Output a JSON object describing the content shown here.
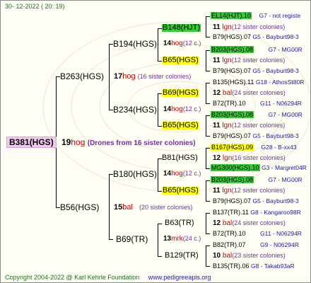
{
  "header": {
    "date": "30-  12-2022  ( 20: 19)"
  },
  "root": {
    "label": "B381(HGS)",
    "num": "19",
    "breeder": "hog",
    "note": "(Drones from 16 sister colonies)"
  },
  "gen1": [
    {
      "label": "B263(HGS)",
      "num": "17",
      "breeder": "hog",
      "note": "(16 sister colonies)"
    },
    {
      "label": "B56(HGS)",
      "num": "15",
      "breeder": "bal",
      "note": "(20 sister colonies)"
    }
  ],
  "gen2": [
    {
      "label": "B194(HGS)",
      "num": "14",
      "breeder": "hog",
      "note": "(12 c.)"
    },
    {
      "label": "B234(HGS)",
      "num": "14",
      "breeder": "hog",
      "note": "(12 c.)"
    },
    {
      "label": "B180(HGS)",
      "num": "14",
      "breeder": "hog",
      "note": "(12 c.)"
    },
    {
      "label": "B69(TR)",
      "num": "13",
      "breeder": "mrk",
      "note": "(24 c.)"
    }
  ],
  "gen3": [
    {
      "label": "B148(HJT)"
    },
    {
      "label": "B65(HGS)"
    },
    {
      "label": "B69(HGS)"
    },
    {
      "label": "B65(HGS)"
    },
    {
      "label": "B81(HGS)"
    },
    {
      "label": "B65(HGS)"
    },
    {
      "label": "B63(TR)"
    },
    {
      "label": "B129(TR)"
    }
  ],
  "gen4": [
    {
      "queen": "EL14(HJT).10",
      "ref": "G7 - not registe",
      "num": "11",
      "breeder": "lgn",
      "note": "(12 sister colonies)",
      "father": "B79(HGS).07",
      "fref": "G5 - Bayburt98-3"
    },
    {
      "queen": "B203(HGS).08",
      "ref": "G7 - MG00R",
      "num": "11",
      "breeder": "lgn",
      "note": "(12 sister colonies)",
      "father": "B79(HGS).07",
      "fref": "G5 - Bayburt98-3"
    },
    {
      "queen": "B135(HGS).11",
      "ref": "G18 - AthosSt80R",
      "num": "12",
      "breeder": "bal",
      "note": "(24 sister colonies)",
      "father": "B72(TR).10",
      "fref": "G11 - N06294R"
    },
    {
      "queen": "B203(HGS).08",
      "ref": "G7 - MG00R",
      "num": "11",
      "breeder": "lgn",
      "note": "(12 sister colonies)",
      "father": "B79(HGS).07",
      "fref": "G5 - Bayburt98-3"
    },
    {
      "queen": "B167(HGS).09",
      "ref": "G28 - B-xx43",
      "num": "12",
      "breeder": "lgn",
      "note": "(16 sister colonies)",
      "father": "MG300(HGS).10",
      "fref": "G3 - Margret04R"
    },
    {
      "queen": "B203(HGS).08",
      "ref": "G7 - MG00R",
      "num": "11",
      "breeder": "lgn",
      "note": "(12 sister colonies)",
      "father": "B79(HGS).07",
      "fref": "G5 - Bayburt98-3"
    },
    {
      "queen": "B137(TR).11",
      "ref": "G8 - Kangaroo98R",
      "num": "12",
      "breeder": "bal",
      "note": "(24 sister colonies)",
      "father": "B72(TR).10",
      "fref": "G11 - N06294R"
    },
    {
      "queen": "B82(TR).07",
      "ref": "G9 - N06294R",
      "num": "10",
      "breeder": "bal",
      "note": "(23 sister colonies)",
      "father": "B135(TR).06",
      "fref": "G8 - Takab93aR"
    }
  ],
  "footer": {
    "copyright": "Copyright 2004-2022 @ Karl Kehrle Foundation",
    "url": "www.pedigreeapis.org"
  },
  "colors": {
    "yellow": "#ffff00",
    "green": "#33cc33",
    "pink": "#f4c8f0",
    "red": "#cc0000",
    "purple": "#7030a0",
    "blue": "#1a1aa6"
  }
}
